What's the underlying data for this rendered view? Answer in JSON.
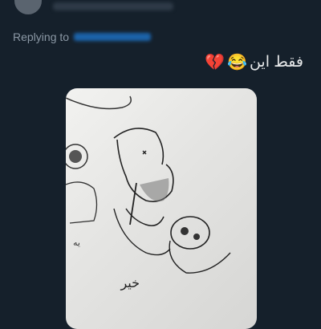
{
  "tweet": {
    "reply_prefix": "Replying to",
    "text": "فقط این",
    "emojis": [
      "😂",
      "💔"
    ]
  },
  "media": {
    "drawing_caption": "خیر",
    "side_scribble": "یه"
  }
}
